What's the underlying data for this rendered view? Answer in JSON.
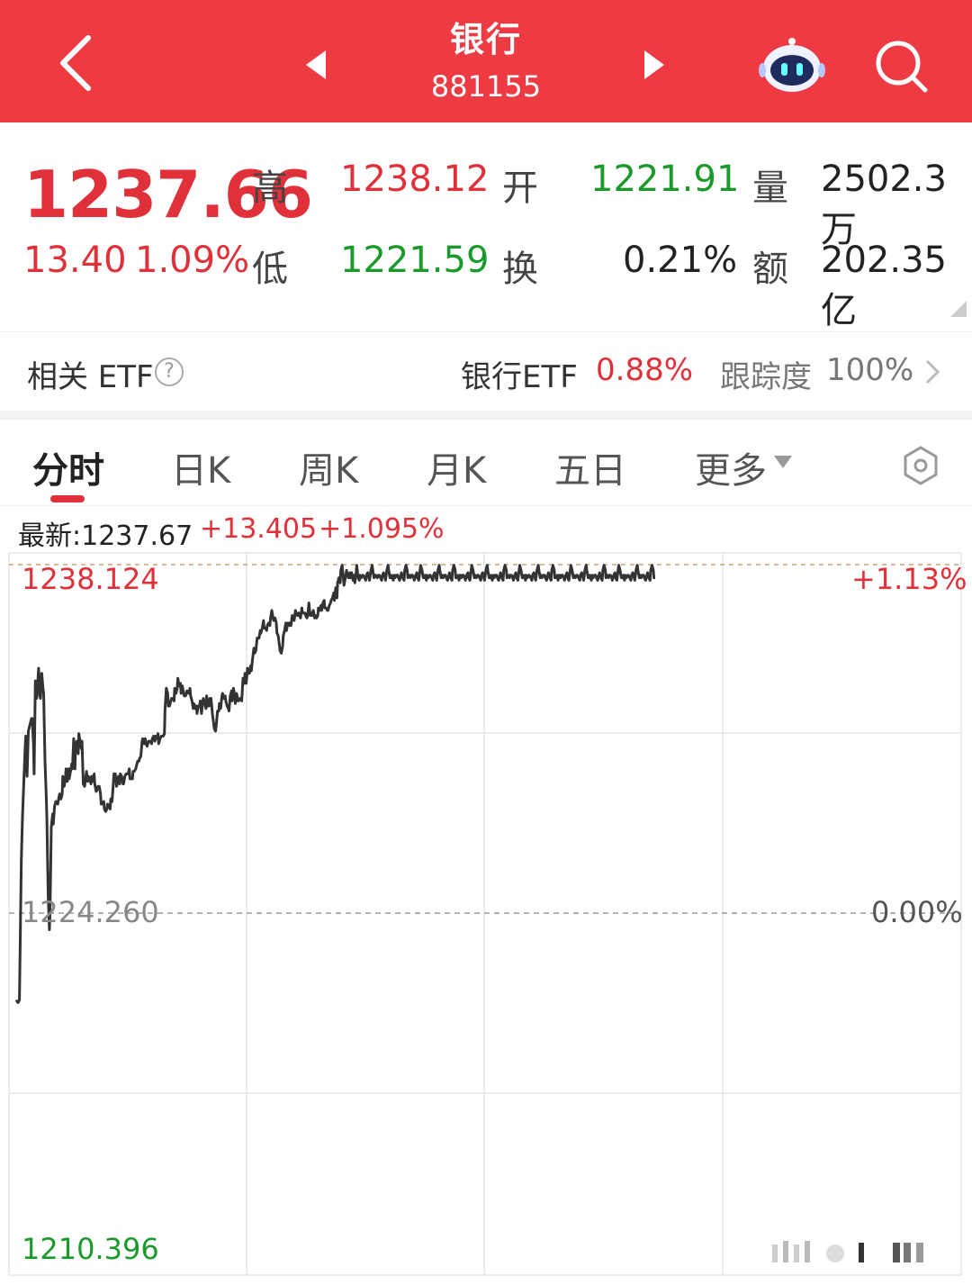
{
  "header": {
    "title": "银行",
    "code": "881155"
  },
  "quote": {
    "price": "1237.66",
    "change": "13.40",
    "change_pct": "1.09%",
    "high_label": "高",
    "high": "1238.12",
    "open_label": "开",
    "open": "1221.91",
    "volume_label": "量",
    "volume": "2502.3万",
    "low_label": "低",
    "low": "1221.59",
    "turnover_label": "换",
    "turnover": "0.21%",
    "amount_label": "额",
    "amount": "202.35亿"
  },
  "etf": {
    "label": "相关 ETF",
    "help": "?",
    "name": "银行ETF",
    "pct": "0.88%",
    "track_label": "跟踪度",
    "track_value": "100%"
  },
  "tabs": [
    {
      "label": "分时",
      "active": true
    },
    {
      "label": "日K"
    },
    {
      "label": "周K"
    },
    {
      "label": "月K"
    },
    {
      "label": "五日"
    },
    {
      "label": "更多"
    }
  ],
  "latest": {
    "label": "最新:1237.67",
    "change": "+13.405",
    "pct": "+1.095%"
  },
  "chart_data": {
    "type": "line",
    "y_top_label": "1238.124",
    "y_mid_label": "1224.260",
    "y_bottom_label": "1210.396",
    "pct_top_label": "+1.13%",
    "pct_mid_label": "0.00%",
    "ylim": [
      1210.396,
      1238.124
    ],
    "baseline": 1224.26,
    "x": [
      0,
      3,
      5,
      8,
      10,
      12,
      14,
      15,
      17,
      19,
      20,
      22,
      24,
      25,
      27,
      28,
      30,
      32,
      33,
      35,
      37,
      38,
      40,
      42,
      43,
      45,
      47,
      48,
      50,
      52,
      53,
      55,
      57,
      58,
      60,
      62,
      63,
      65,
      67,
      68,
      70,
      72,
      73,
      75,
      77,
      78,
      80,
      82,
      83,
      85,
      87,
      88,
      90,
      92,
      93,
      95,
      97,
      98,
      100,
      102,
      103,
      105,
      107,
      108,
      110,
      112,
      113,
      115,
      117,
      118,
      120,
      122,
      123,
      125,
      127,
      128,
      130,
      132,
      133,
      135,
      137,
      138,
      140,
      142,
      143,
      145,
      147,
      148,
      150,
      152,
      153,
      155,
      157,
      158,
      160,
      162,
      163,
      165,
      167,
      168,
      170,
      172,
      173,
      175,
      177,
      178,
      180,
      182,
      183,
      185,
      187,
      188,
      190,
      192,
      193,
      195,
      197,
      198,
      200,
      202,
      203,
      205,
      207,
      208,
      210,
      212,
      213,
      215,
      217,
      218,
      220,
      222,
      223,
      225,
      227,
      228,
      230,
      232,
      233,
      235,
      237,
      238,
      240,
      242,
      243,
      245,
      247,
      248,
      250,
      252,
      253,
      255,
      257,
      258,
      260,
      262,
      263,
      265,
      267,
      268,
      270,
      272,
      273,
      275,
      277,
      278,
      280,
      282,
      283,
      285,
      287,
      288,
      290,
      292,
      293,
      295,
      297,
      298,
      300,
      302,
      303,
      305,
      307,
      308,
      310,
      312,
      313,
      315,
      317,
      318,
      320,
      322,
      323,
      325,
      327,
      328,
      330,
      332,
      333,
      335,
      337,
      338,
      340,
      342,
      343,
      345,
      347,
      348,
      350,
      352,
      353,
      355,
      357,
      358,
      360,
      362,
      363,
      365,
      367,
      368,
      370,
      372,
      373,
      375,
      377,
      378,
      380,
      382,
      383,
      385,
      387,
      388,
      390,
      392,
      393,
      395,
      397,
      398,
      400,
      402,
      403,
      405,
      407,
      408,
      410,
      412,
      413,
      415,
      417,
      418,
      420,
      422,
      423,
      425,
      427,
      428,
      430,
      432,
      433,
      435,
      437,
      438,
      440,
      442,
      443,
      445,
      447,
      448,
      450,
      452,
      453,
      455,
      457,
      458,
      460,
      462,
      463,
      465,
      467,
      468,
      470,
      472,
      473,
      475,
      477,
      478,
      480,
      482,
      483,
      485,
      487,
      488,
      490,
      492,
      493,
      495,
      497,
      498,
      500,
      502,
      503,
      505,
      507,
      508,
      510,
      512,
      513,
      515,
      517,
      518,
      520,
      522,
      523,
      525,
      527,
      528,
      530,
      532,
      533,
      535,
      537,
      538,
      540,
      542,
      543,
      545,
      547,
      548,
      550,
      552,
      553,
      555,
      557,
      558,
      560,
      562,
      563,
      565,
      567,
      568,
      570,
      572,
      573,
      575,
      577,
      578,
      580,
      582,
      583,
      585,
      587,
      588,
      590,
      592,
      593,
      595,
      597,
      598,
      600,
      602,
      603,
      605,
      607,
      608,
      610,
      612,
      613,
      615,
      617,
      618,
      620,
      622,
      623,
      625,
      627,
      628,
      630,
      632,
      633,
      635,
      637,
      638,
      640,
      642,
      643,
      645,
      647,
      648,
      650,
      652,
      653,
      655,
      657,
      658,
      660,
      662,
      663,
      665,
      667,
      668,
      670,
      672,
      673,
      675,
      677,
      678,
      680,
      682,
      683,
      685,
      687,
      688,
      690,
      692,
      693,
      695,
      697,
      698,
      700,
      702,
      703,
      705,
      707,
      708,
      710,
      712,
      713,
      715,
      717,
      718,
      720,
      722,
      723,
      725,
      727,
      728,
      730,
      732,
      733,
      735,
      737,
      738,
      740,
      742,
      743,
      745,
      747,
      748,
      750,
      752,
      753,
      755,
      757,
      758,
      760,
      762,
      763,
      765,
      767,
      768,
      770,
      772,
      773,
      775,
      777,
      778,
      780,
      782,
      783,
      785,
      787,
      788,
      790,
      792,
      793,
      795,
      797,
      798,
      800,
      802,
      803,
      805,
      807,
      808,
      810,
      812,
      813,
      815,
      817,
      818,
      820,
      822,
      823,
      825,
      827,
      828,
      830,
      832,
      833,
      835,
      837,
      838,
      840,
      842,
      843,
      845,
      847,
      848,
      850,
      852,
      853,
      855,
      857,
      858,
      860,
      862,
      863,
      865,
      867,
      868,
      870,
      872,
      873,
      875,
      877,
      878,
      880,
      882,
      883,
      885,
      887,
      888,
      890,
      892,
      893,
      895,
      897,
      898,
      900,
      902,
      903,
      905,
      907,
      908,
      910,
      912,
      913,
      915,
      917,
      918,
      920,
      922,
      923,
      925,
      927,
      928,
      930,
      932,
      933,
      935,
      937,
      938,
      940,
      942,
      943,
      945,
      947,
      948,
      950,
      952,
      953,
      955,
      957,
      958,
      960,
      962,
      963,
      965,
      967,
      968,
      970,
      972,
      973,
      975,
      977,
      978,
      980,
      982,
      983,
      985,
      987,
      988,
      990,
      992,
      993,
      995,
      997,
      998,
      1000
    ],
    "values": [
      1220.8,
      1220.7,
      1220.8,
      1226.4,
      1228.2,
      1229.5,
      1230.8,
      1231.3,
      1229.7,
      1231.5,
      1231.6,
      1231.8,
      1232.0,
      1232.0,
      1231.0,
      1229.8,
      1233.5,
      1232.8,
      1233.1,
      1234.0,
      1232.9,
      1232.8,
      1233.8,
      1233.2,
      1233.0,
      1230.3,
      1228.9,
      1228.0,
      1225.0,
      1223.6,
      1224.3,
      1227.7,
      1228.2,
      1227.8,
      1228.5,
      1228.7,
      1228.7,
      1228.6,
      1228.9,
      1229.0,
      1228.8,
      1229.0,
      1229.7,
      1229.3,
      1229.6,
      1230.0,
      1229.5,
      1230.0,
      1229.6,
      1229.9,
      1230.2,
      1230.0,
      1231.2,
      1230.0,
      1231.0,
      1231.1,
      1230.6,
      1231.4,
      1231.1,
      1230.8,
      1231.1,
      1229.4,
      1229.3,
      1229.5,
      1229.9,
      1229.5,
      1229.7,
      1229.6,
      1229.4,
      1229.7,
      1229.5,
      1229.8,
      1229.4,
      1229.1,
      1229.2,
      1229.3,
      1229.3,
      1229.0,
      1228.6,
      1228.6,
      1228.7,
      1228.4,
      1228.3,
      1228.4,
      1228.6,
      1228.5,
      1228.4,
      1228.8,
      1228.7,
      1229.4,
      1229.8,
      1229.8,
      1229.3,
      1229.4,
      1229.7,
      1229.4,
      1229.8,
      1229.7,
      1229.4,
      1229.4,
      1229.7,
      1229.8,
      1229.8,
      1229.8,
      1230.0,
      1229.6,
      1229.6,
      1229.6,
      1229.9,
      1229.9,
      1230.0,
      1230.1,
      1230.3,
      1230.3,
      1230.4,
      1230.5,
      1231.1,
      1231.2,
      1231.0,
      1231.2,
      1231.0,
      1230.9,
      1231.1,
      1231.1,
      1231.1,
      1231.0,
      1231.2,
      1231.3,
      1231.1,
      1231.3,
      1231.2,
      1231.4,
      1231.0,
      1231.2,
      1231.3,
      1231.3,
      1231.3,
      1231.4,
      1232.4,
      1233.2,
      1233.0,
      1232.5,
      1232.5,
      1232.7,
      1232.8,
      1232.8,
      1232.7,
      1233.2,
      1233.0,
      1233.2,
      1233.6,
      1233.3,
      1233.4,
      1233.0,
      1233.3,
      1233.0,
      1232.9,
      1232.9,
      1233.1,
      1233.1,
      1233.0,
      1233.2,
      1232.9,
      1232.7,
      1232.4,
      1232.6,
      1232.4,
      1232.5,
      1232.2,
      1232.5,
      1232.5,
      1232.7,
      1232.2,
      1232.7,
      1232.8,
      1232.6,
      1232.4,
      1232.9,
      1232.5,
      1232.5,
      1232.8,
      1232.8,
      1232.2,
      1232.0,
      1231.6,
      1231.5,
      1231.7,
      1232.3,
      1232.3,
      1232.6,
      1232.4,
      1232.9,
      1233.0,
      1232.8,
      1232.9,
      1232.7,
      1232.5,
      1232.4,
      1232.3,
      1232.9,
      1233.1,
      1232.7,
      1233.2,
      1232.9,
      1232.6,
      1233.0,
      1232.7,
      1232.7,
      1232.8,
      1232.8,
      1232.7,
      1233.6,
      1233.4,
      1233.8,
      1233.4,
      1234.0,
      1233.8,
      1233.8,
      1234.1,
      1233.9,
      1234.4,
      1234.8,
      1234.6,
      1234.7,
      1235.2,
      1235.2,
      1235.2,
      1235.5,
      1235.4,
      1235.6,
      1235.9,
      1235.6,
      1235.6,
      1235.5,
      1235.7,
      1235.8,
      1235.7,
      1236.0,
      1236.3,
      1236.0,
      1235.9,
      1236.0,
      1235.8,
      1235.4,
      1235.3,
      1234.9,
      1234.7,
      1234.6,
      1234.9,
      1235.3,
      1235.5,
      1235.8,
      1235.5,
      1235.8,
      1235.7,
      1235.8,
      1235.7,
      1236.1,
      1236.0,
      1235.9,
      1236.3,
      1236.2,
      1236.1,
      1236.2,
      1236.1,
      1236.0,
      1236.4,
      1236.2,
      1236.2,
      1236.2,
      1236.1,
      1236.0,
      1236.3,
      1236.6,
      1236.1,
      1236.2,
      1236.1,
      1236.3,
      1236.0,
      1236.1,
      1236.0,
      1236.1,
      1236.4,
      1236.3,
      1236.5,
      1236.3,
      1236.6,
      1236.7,
      1236.4,
      1236.4,
      1236.3,
      1236.3,
      1236.5,
      1236.6,
      1236.7,
      1236.8,
      1237.0,
      1236.7,
      1237.2,
      1236.8,
      1237.4,
      1237.6,
      1237.4,
      1237.9,
      1238.1,
      1237.6,
      1237.3,
      1237.6,
      1237.9,
      1237.7,
      1237.6,
      1237.8,
      1237.6,
      1237.8,
      1237.5,
      1237.7,
      1237.4,
      1237.8,
      1238.1,
      1237.6,
      1237.5,
      1237.7,
      1237.6,
      1237.7,
      1237.7,
      1237.6,
      1237.5,
      1237.7,
      1237.8,
      1237.6,
      1237.5,
      1237.9,
      1238.1,
      1237.9,
      1237.6,
      1237.7,
      1237.7,
      1237.6,
      1237.7,
      1237.7,
      1237.6,
      1237.5,
      1237.7,
      1237.8,
      1237.6,
      1237.5,
      1237.9,
      1238.1,
      1237.9,
      1237.6,
      1237.6,
      1237.7,
      1237.5,
      1237.7,
      1237.6,
      1237.7,
      1237.7,
      1237.6,
      1237.5,
      1237.7,
      1237.8,
      1237.6,
      1237.5,
      1237.9,
      1238.1,
      1237.9,
      1237.6,
      1237.7,
      1237.6,
      1237.7,
      1237.7,
      1237.6,
      1237.5,
      1237.7,
      1237.8,
      1237.6,
      1237.5,
      1237.9,
      1238.1,
      1237.9,
      1237.6,
      1237.6,
      1237.7,
      1237.5,
      1237.7,
      1237.6,
      1237.7,
      1237.7,
      1237.6,
      1237.5,
      1237.7,
      1237.8,
      1237.6,
      1237.5,
      1237.9,
      1238.1,
      1237.9,
      1237.6,
      1237.7,
      1237.6,
      1237.7,
      1237.7,
      1237.6,
      1237.5,
      1237.7,
      1237.8,
      1237.6,
      1237.5,
      1237.9,
      1238.1,
      1237.9,
      1237.6,
      1237.6,
      1237.7,
      1237.5,
      1237.7,
      1237.6,
      1237.7,
      1237.7,
      1237.6,
      1237.5,
      1237.7,
      1237.8,
      1237.6,
      1237.5,
      1237.9,
      1238.1,
      1237.9,
      1237.6,
      1237.7,
      1237.6,
      1237.7,
      1237.7,
      1237.6,
      1237.5,
      1237.7,
      1237.8,
      1237.6,
      1237.5,
      1237.9,
      1238.1,
      1237.9,
      1237.6,
      1237.6,
      1237.7,
      1237.5,
      1237.7,
      1237.6,
      1237.7,
      1237.7,
      1237.6,
      1237.5,
      1237.7,
      1237.8,
      1237.6,
      1237.5,
      1237.9,
      1238.1,
      1237.9,
      1237.6,
      1237.7,
      1237.6,
      1237.7,
      1237.7,
      1237.6,
      1237.5,
      1237.7,
      1237.8,
      1237.6,
      1237.5,
      1237.9,
      1238.1,
      1237.9,
      1237.6,
      1237.6,
      1237.7,
      1237.5,
      1237.7,
      1237.6,
      1237.7,
      1237.7,
      1237.6,
      1237.5,
      1237.7,
      1237.8,
      1237.6,
      1237.5,
      1237.9,
      1238.1,
      1237.9,
      1237.6,
      1237.7,
      1237.6,
      1237.7,
      1237.7,
      1237.6,
      1237.5,
      1237.7,
      1237.8,
      1237.6,
      1237.5,
      1237.9,
      1238.1,
      1237.9,
      1237.6,
      1237.6,
      1237.7,
      1237.5,
      1237.7,
      1237.6,
      1237.7,
      1237.7,
      1237.6,
      1237.5,
      1237.7,
      1237.8,
      1237.6,
      1237.5,
      1237.9,
      1238.1,
      1237.9,
      1237.6,
      1237.7,
      1237.6,
      1237.7,
      1237.7,
      1237.6,
      1237.5,
      1237.7,
      1237.8,
      1237.6,
      1237.5,
      1237.9,
      1238.1,
      1237.9,
      1237.6,
      1237.6,
      1237.7,
      1237.5,
      1237.7,
      1237.6,
      1237.7,
      1237.7,
      1237.6,
      1237.5,
      1237.7,
      1237.8,
      1237.6,
      1237.5,
      1237.9,
      1238.1,
      1237.9,
      1237.6,
      1237.7,
      1237.6,
      1237.7,
      1237.7,
      1237.6,
      1237.5,
      1237.7,
      1237.8,
      1237.6,
      1237.5,
      1237.9,
      1238.1,
      1237.9,
      1237.6,
      1237.6,
      1237.7,
      1237.5,
      1237.7,
      1237.6,
      1237.7,
      1237.7,
      1237.6,
      1237.5,
      1237.7,
      1237.8,
      1237.6,
      1237.5,
      1237.9,
      1238.1,
      1237.9,
      1237.6,
      1237.7,
      1237.6,
      1237.7,
      1237.7,
      1237.6,
      1237.5,
      1237.7,
      1237.8,
      1237.6,
      1237.5,
      1237.9,
      1238.1,
      1237.9,
      1237.6,
      1237.6,
      1237.7,
      1237.5,
      1237.7,
      1237.6,
      1237.7,
      1237.7,
      1237.6,
      1237.5,
      1237.7,
      1237.8,
      1237.6,
      1237.5,
      1237.9,
      1238.1,
      1237.9,
      1237.6,
      1237.7,
      1237.6,
      1237.7,
      1237.7,
      1237.6,
      1237.5,
      1237.7,
      1237.8,
      1237.6,
      1237.5,
      1237.9,
      1238.1,
      1237.9,
      1237.6,
      1237.6,
      1237.7,
      1237.5,
      1237.7,
      1237.6,
      1237.7,
      1237.7,
      1237.6,
      1237.5,
      1237.7,
      1237.8,
      1237.6,
      1237.5,
      1237.9,
      1238.1,
      1237.9,
      1237.6
    ],
    "series_end_x": 1000,
    "colors": {
      "line": "#333333",
      "grid": "#e6e6e6",
      "baseline": "#999999",
      "top_ref": "#c9a27a"
    }
  },
  "colors": {
    "header": "#ee3a43",
    "up": "#e0303a",
    "down": "#1a9a2a"
  }
}
